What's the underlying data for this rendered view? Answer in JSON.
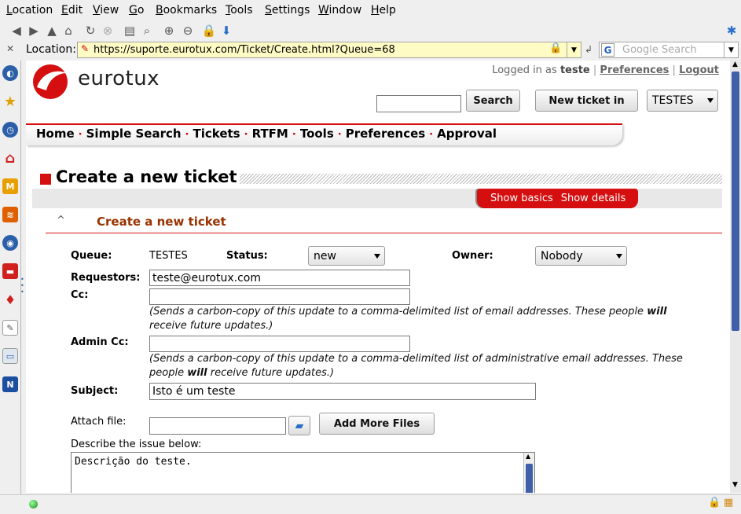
{
  "menu": [
    "Location",
    "Edit",
    "View",
    "Go",
    "Bookmarks",
    "Tools",
    "Settings",
    "Window",
    "Help"
  ],
  "location": {
    "label": "Location:",
    "url": "https://suporte.eurotux.com/Ticket/Create.html?Queue=68",
    "search_placeholder": "Google Search"
  },
  "brand": {
    "name": "eurotux"
  },
  "header": {
    "logged_in_prefix": "Logged in as",
    "username": "teste",
    "preferences_link": "Preferences",
    "logout_link": "Logout",
    "search_button": "Search",
    "new_ticket_button": "New ticket in",
    "queue_select": "TESTES"
  },
  "nav": [
    "Home",
    "Simple Search",
    "Tickets",
    "RTFM",
    "Tools",
    "Preferences",
    "Approval"
  ],
  "page_title": "Create a new ticket",
  "tabs": {
    "show_basics": "Show basics",
    "show_details": "Show details"
  },
  "section_title": "Create a new ticket",
  "form": {
    "queue_label": "Queue:",
    "queue_value": "TESTES",
    "status_label": "Status:",
    "status_value": "new",
    "owner_label": "Owner:",
    "owner_value": "Nobody",
    "requestors_label": "Requestors:",
    "requestors_value": "teste@eurotux.com",
    "cc_label": "Cc:",
    "cc_value": "",
    "cc_hint_a": "(Sends a carbon-copy of this update to a comma-delimited list of email addresses. These people ",
    "cc_hint_will": "will",
    "cc_hint_b": "receive future updates.)",
    "admincc_label": "Admin Cc:",
    "admincc_value": "",
    "admincc_hint_a": "(Sends a carbon-copy of this update to a comma-delimited list of administrative email addresses. These",
    "admincc_hint_b_pre": "people ",
    "admincc_hint_will": "will",
    "admincc_hint_b_post": " receive future updates.)",
    "subject_label": "Subject:",
    "subject_value": "Isto é um teste",
    "attach_label": "Attach file:",
    "add_files_button": "Add More Files",
    "describe_label": "Describe the issue below:",
    "description_value": "Descrição do teste."
  },
  "colors": {
    "brand_red": "#d50f0f",
    "section_title": "#993300",
    "url_bg": "#fffbc4"
  }
}
